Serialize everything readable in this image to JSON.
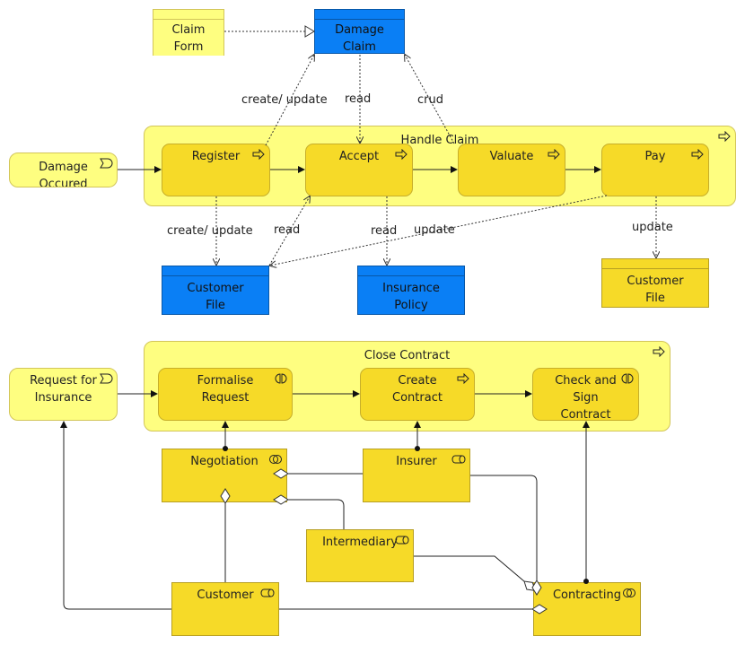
{
  "colors": {
    "group": "#fefe80",
    "process": "#f6da28",
    "data_object": "#0a7ff5",
    "actor": "#f6da28"
  },
  "top": {
    "claim_form": "Claim Form",
    "damage_claim": "Damage Claim",
    "handle_claim": "Handle Claim",
    "damage_occured": "Damage Occured",
    "register": "Register",
    "accept": "Accept",
    "valuate": "Valuate",
    "pay": "Pay",
    "customer_file_blue": "Customer File",
    "insurance_policy": "Insurance Policy",
    "customer_file_yellow": "Customer File",
    "labels": {
      "register_damage_claim": "create/ update",
      "accept_damage_claim": "read",
      "valuate_damage_claim": "crud",
      "register_customer_file": "create/ update",
      "accept_customer_file": "read",
      "accept_insurance_policy": "read",
      "pay_customer_file": "update",
      "pay_customer_file_yellow": "update"
    }
  },
  "bottom": {
    "close_contract": "Close Contract",
    "request_for_insurance": "Request for Insurance",
    "formalise_request": "Formalise Request",
    "create_contract": "Create Contract",
    "check_and_sign": "Check and Sign Contract",
    "negotiation": "Negotiation",
    "insurer": "Insurer",
    "intermediary": "Intermediary",
    "customer": "Customer",
    "contracting": "Contracting"
  }
}
